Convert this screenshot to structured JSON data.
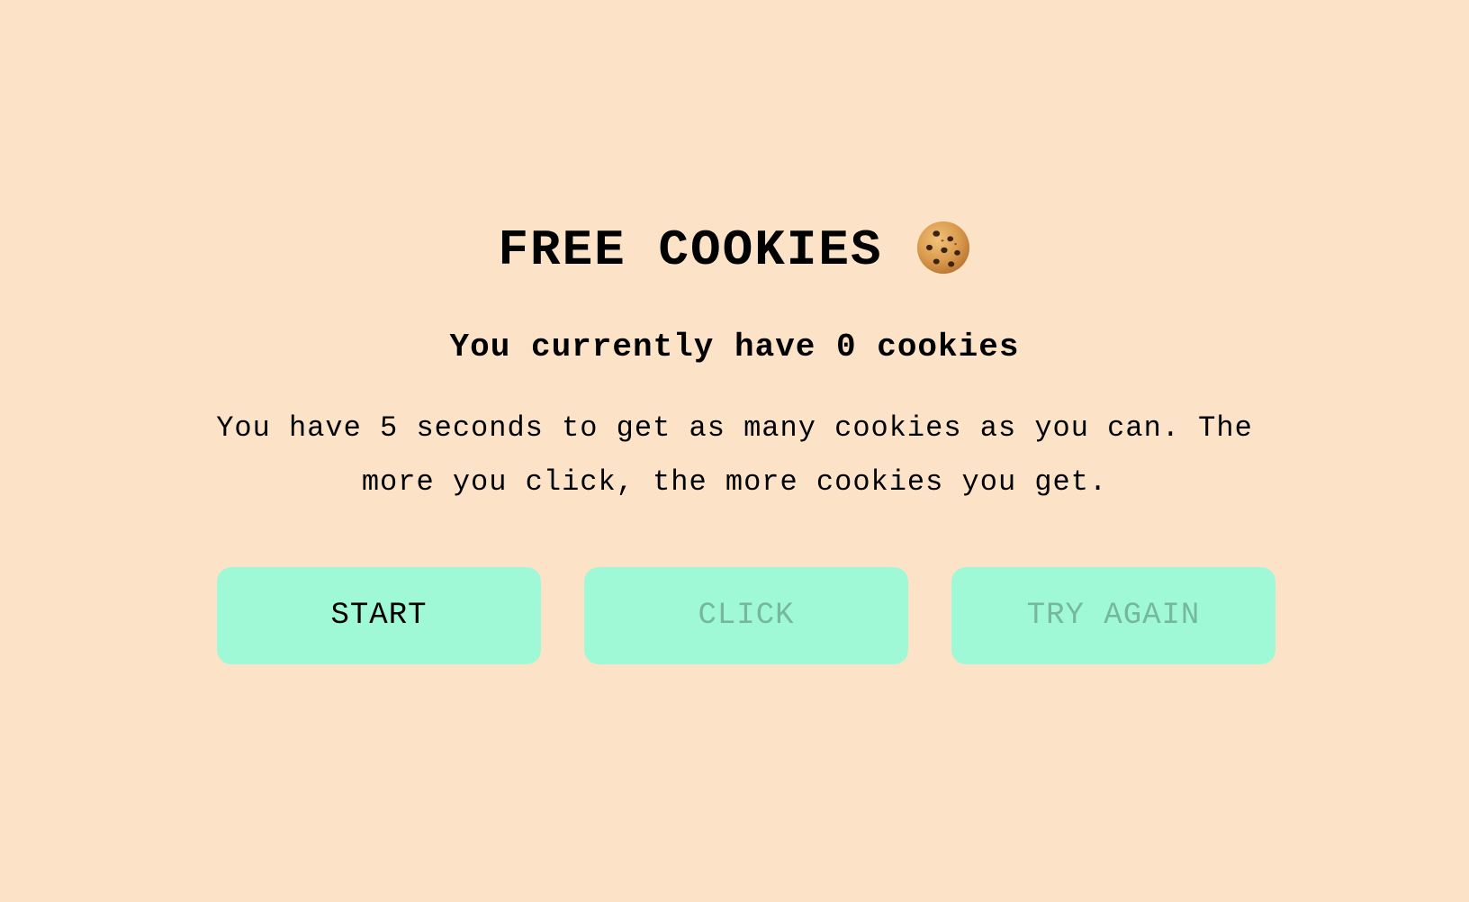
{
  "header": {
    "title": "FREE COOKIES",
    "title_icon": "cookie-icon"
  },
  "status": {
    "cookie_count_text": "You currently have 0 cookies",
    "cookie_count": 0
  },
  "instructions": {
    "text": "You have 5 seconds to get as many cookies as you can. The more you click, the more cookies you get."
  },
  "buttons": {
    "start": {
      "label": "START",
      "enabled": true
    },
    "click": {
      "label": "CLICK",
      "enabled": false
    },
    "try_again": {
      "label": "TRY AGAIN",
      "enabled": false
    }
  },
  "colors": {
    "background": "#fce3c8",
    "button_bg": "#a0f9d6",
    "disabled_text": "#76b89e",
    "text": "#000000"
  }
}
